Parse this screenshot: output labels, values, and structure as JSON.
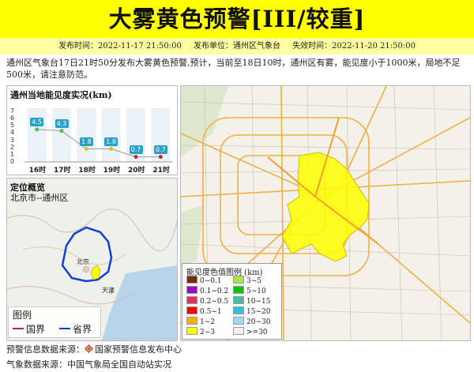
{
  "banner": {
    "title": "大雾黄色预警[III/较重]"
  },
  "meta": {
    "issue_time": "发布时间：2022-11-17 21:50:00",
    "issuer": "发布单位：通州区气象台",
    "expire_time": "失效时间：2022-11-20 21:50:00"
  },
  "description": "通州区气象台17日21时50分发布大雾黄色预警,预计，当前至18日10时，通州区有雾，能见度小于1000米，局地不足500米，请注意防范。",
  "chart_panel": {
    "title": "通州当地能见度实况(km)"
  },
  "chart_data": {
    "type": "line",
    "title": "通州当地能见度实况(km)",
    "categories": [
      "16时",
      "17时",
      "18时",
      "19时",
      "20时",
      "21时"
    ],
    "values": [
      4.5,
      4.3,
      1.8,
      1.8,
      0.7,
      0.7
    ],
    "ylim": [
      0,
      7
    ],
    "yticks": [
      "0",
      "1",
      "2",
      "3",
      "4",
      "5",
      "6",
      "7"
    ],
    "point_colors": [
      "#4dc24a",
      "#4dc24a",
      "#e0c800",
      "#e0c800",
      "#d02020",
      "#d02020"
    ],
    "line_color": "#999999"
  },
  "location_panel": {
    "title": "定位概览",
    "subtitle": "北京市--通州区"
  },
  "inset_legend": {
    "title": "图例",
    "items": [
      {
        "label": "国界",
        "color": "#c02040"
      },
      {
        "label": "省界",
        "color": "#1040c0"
      }
    ]
  },
  "map_legend": {
    "title": "能见度色值图例 (km)",
    "items": [
      {
        "label": "0~0.1",
        "color": "#7a2a14"
      },
      {
        "label": "0.1~0.2",
        "color": "#a000c8"
      },
      {
        "label": "0.2~0.5",
        "color": "#e03060"
      },
      {
        "label": "0.5~1",
        "color": "#ff0000"
      },
      {
        "label": "1~2",
        "color": "#ffb000"
      },
      {
        "label": "2~3",
        "color": "#ffff00"
      },
      {
        "label": "3~5",
        "color": "#a8e84a"
      },
      {
        "label": "5~10",
        "color": "#00c800"
      },
      {
        "label": "10~15",
        "color": "#40c0a0"
      },
      {
        "label": "15~20",
        "color": "#30c0e0"
      },
      {
        "label": "20~30",
        "color": "#a0d8f0"
      },
      {
        "label": ">=30",
        "color": "#f0f0f0"
      }
    ]
  },
  "map_labels": {
    "beijing": "北京",
    "tianjin": "天津"
  },
  "footer": {
    "warning_source": "预警信息数据来源：",
    "warning_source_name": "国家预警信息发布中心",
    "weather_source": "气象数据来源：中国气象局全国自动站实况"
  }
}
